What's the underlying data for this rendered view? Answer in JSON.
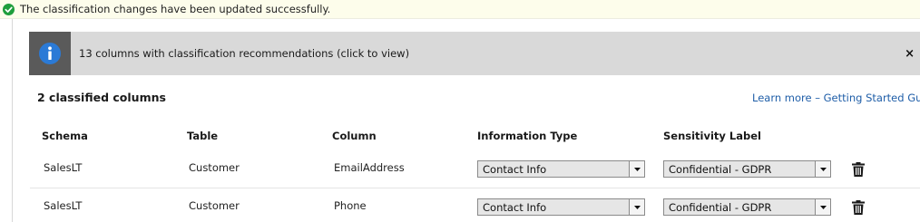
{
  "notification": {
    "message": "The classification changes have been updated successfully.",
    "icon": "check-circle-icon",
    "icon_color": "#1e9e3c"
  },
  "recommendations_banner": {
    "text": "13 columns with classification recommendations (click to view)",
    "icon": "info-icon",
    "icon_color": "#2b7ad6",
    "close_label": "×"
  },
  "classified": {
    "title": "2 classified columns",
    "learn_more": "Learn more – Getting Started Guide"
  },
  "table": {
    "headers": {
      "schema": "Schema",
      "table": "Table",
      "column": "Column",
      "information_type": "Information Type",
      "sensitivity_label": "Sensitivity Label"
    },
    "rows": [
      {
        "schema": "SalesLT",
        "table": "Customer",
        "column": "EmailAddress",
        "information_type": "Contact Info",
        "sensitivity_label": "Confidential - GDPR"
      },
      {
        "schema": "SalesLT",
        "table": "Customer",
        "column": "Phone",
        "information_type": "Contact Info",
        "sensitivity_label": "Confidential - GDPR"
      }
    ]
  }
}
